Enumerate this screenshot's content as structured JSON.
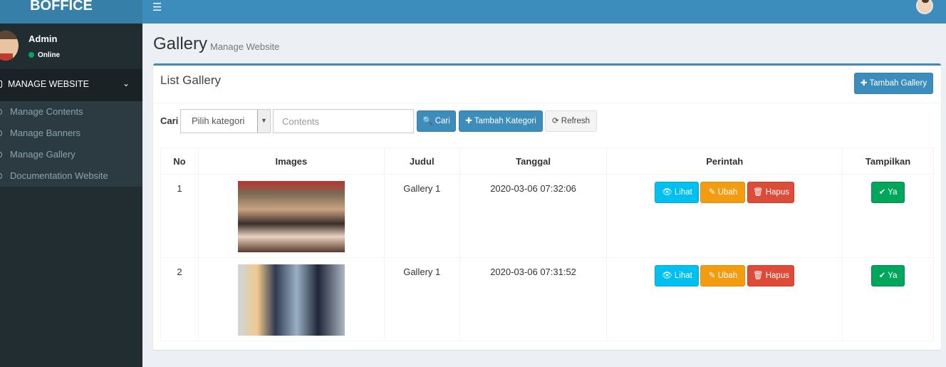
{
  "brand": {
    "logo_text": "BOFFICE"
  },
  "navbar": {
    "menu_icon": "☰"
  },
  "user": {
    "name": "Admin",
    "status": "Online"
  },
  "sidebar": {
    "section_label": "MANAGE WEBSITE",
    "chevron": "⌄",
    "items": [
      {
        "label": "Manage Contents"
      },
      {
        "label": "Manage Banners"
      },
      {
        "label": "Manage Gallery"
      },
      {
        "label": "Documentation Website"
      }
    ]
  },
  "page": {
    "title": "Gallery",
    "subtitle": "Manage Website"
  },
  "box": {
    "title": "List Gallery",
    "add_gallery_label": "✚ Tambah Gallery"
  },
  "filter": {
    "label": "Cari",
    "category_selected": "Pilih kategori",
    "search_placeholder": "Contents",
    "search_button": "🔍 Cari",
    "add_category_button": "✚ Tambah Kategori",
    "refresh_button": "⟳ Refresh"
  },
  "table": {
    "headers": [
      "No",
      "Images",
      "Judul",
      "Tanggal",
      "Perintah",
      "Tampilkan"
    ],
    "rows": [
      {
        "no": "1",
        "judul": "Gallery 1",
        "tanggal": "2020-03-06 07:32:06",
        "view": "👁 Lihat",
        "edit": "✎ Ubah",
        "delete": "🗑 Hapus",
        "show": "✔ Ya"
      },
      {
        "no": "2",
        "judul": "Gallery 1",
        "tanggal": "2020-03-06 07:31:52",
        "view": "👁 Lihat",
        "edit": "✎ Ubah",
        "delete": "🗑 Hapus",
        "show": "✔ Ya"
      }
    ]
  },
  "colors": {
    "primary": "#3c8dbc",
    "sidebar": "#222d32",
    "info": "#00c0ef",
    "warning": "#f39c12",
    "danger": "#dd4b39",
    "success": "#00a65a"
  }
}
